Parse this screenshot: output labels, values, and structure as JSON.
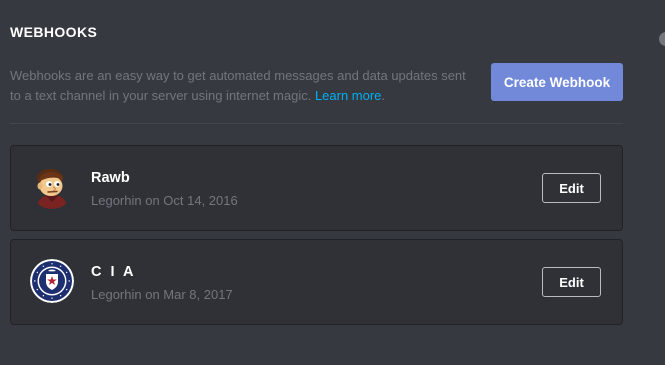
{
  "section": {
    "title": "WEBHOOKS",
    "description": "Webhooks are an easy way to get automated messages and data updates sent to a text channel in your server using internet magic. ",
    "learn_more": "Learn more",
    "trailing": "."
  },
  "actions": {
    "create_label": "Create Webhook"
  },
  "webhooks": [
    {
      "name": "Rawb",
      "meta": "Legorhin on Oct 14, 2016",
      "edit_label": "Edit",
      "avatar_icon": "cartoon-face-icon"
    },
    {
      "name": "C I A",
      "meta": "Legorhin on Mar 8, 2017",
      "edit_label": "Edit",
      "avatar_icon": "cia-seal-icon"
    }
  ],
  "colors": {
    "background": "#36393f",
    "card": "#2f3136",
    "accent": "#7289da",
    "link": "#00b0f4",
    "muted": "#72767d"
  }
}
